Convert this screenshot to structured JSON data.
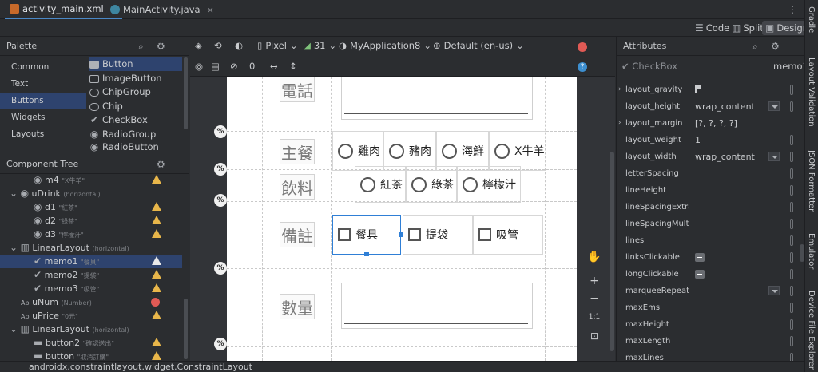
{
  "tabs": [
    {
      "label": "activity_main.xml",
      "active": true
    },
    {
      "label": "MainActivity.java",
      "active": false
    }
  ],
  "modes": {
    "code": "Code",
    "split": "Split",
    "design": "Design"
  },
  "palette": {
    "title": "Palette",
    "categories": [
      "Common",
      "Text",
      "Buttons",
      "Widgets",
      "Layouts"
    ],
    "items": [
      "Button",
      "ImageButton",
      "ChipGroup",
      "Chip",
      "CheckBox",
      "RadioGroup",
      "RadioButton"
    ]
  },
  "design_toolbar": {
    "device": "Pixel",
    "api": "31",
    "app": "MyApplication8",
    "locale": "Default (en-us)"
  },
  "component_tree": {
    "title": "Component Tree",
    "rows": [
      {
        "label": "m4",
        "sub": "\"X牛羊\""
      },
      {
        "label": "uDrink",
        "sub": "(horizontal)"
      },
      {
        "label": "d1",
        "sub": "\"紅茶\""
      },
      {
        "label": "d2",
        "sub": "\"綠茶\""
      },
      {
        "label": "d3",
        "sub": "\"檸檬汁\""
      },
      {
        "label": "LinearLayout",
        "sub": "(horizontal)"
      },
      {
        "label": "memo1",
        "sub": "\"餐具\""
      },
      {
        "label": "memo2",
        "sub": "\"提袋\""
      },
      {
        "label": "memo3",
        "sub": "\"吸管\""
      },
      {
        "label": "uNum",
        "sub": "(Number)"
      },
      {
        "label": "uPrice",
        "sub": "\"0元\""
      },
      {
        "label": "LinearLayout",
        "sub": "(horizontal)"
      },
      {
        "label": "button2",
        "sub": "\"確認送出\""
      },
      {
        "label": "button",
        "sub": "\"取消訂購\""
      }
    ]
  },
  "form": {
    "labels": {
      "phone": "電話",
      "main": "主餐",
      "drink": "飲料",
      "memo": "備註",
      "qty": "數量"
    },
    "main_options": [
      "雞肉",
      "豬肉",
      "海鮮",
      "X牛羊"
    ],
    "drink_options": [
      "紅茶",
      "綠茶",
      "檸檬汁"
    ],
    "memo_options": [
      "餐具",
      "提袋",
      "吸管"
    ],
    "pct_badge": "%"
  },
  "zoom": {
    "hand": "✋",
    "plus": "+",
    "minus": "−",
    "one": "1:1"
  },
  "attributes": {
    "title": "Attributes",
    "component": "CheckBox",
    "id": "memo1",
    "rows": [
      {
        "name": "layout_gravity",
        "value": ""
      },
      {
        "name": "layout_height",
        "value": "wrap_content"
      },
      {
        "name": "layout_margin",
        "value": "[?, ?, ?, ?]"
      },
      {
        "name": "layout_weight",
        "value": "1"
      },
      {
        "name": "layout_width",
        "value": "wrap_content"
      },
      {
        "name": "letterSpacing",
        "value": ""
      },
      {
        "name": "lineHeight",
        "value": ""
      },
      {
        "name": "lineSpacingExtra",
        "value": ""
      },
      {
        "name": "lineSpacingMulti...",
        "value": ""
      },
      {
        "name": "lines",
        "value": ""
      },
      {
        "name": "linksClickable",
        "value": ""
      },
      {
        "name": "longClickable",
        "value": ""
      },
      {
        "name": "marqueeRepeat...",
        "value": ""
      },
      {
        "name": "maxEms",
        "value": ""
      },
      {
        "name": "maxHeight",
        "value": ""
      },
      {
        "name": "maxLength",
        "value": ""
      },
      {
        "name": "maxLines",
        "value": ""
      }
    ]
  },
  "right_sidebar": [
    "Gradle",
    "Layout Validation",
    "JSON Formatter",
    "Emulator",
    "Device File Explorer"
  ],
  "status": "androidx.constraintlayout.widget.ConstraintLayout"
}
